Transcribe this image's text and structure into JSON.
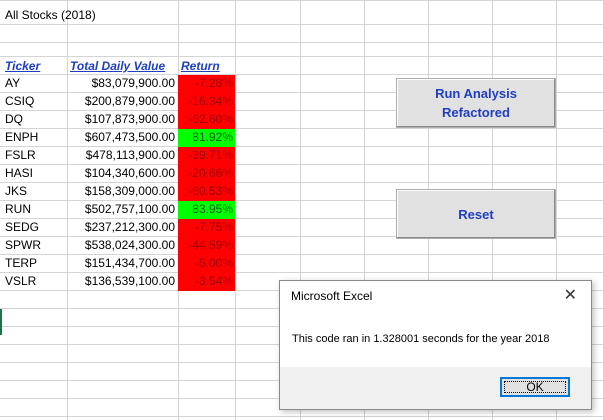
{
  "sheet": {
    "title": "All Stocks (2018)",
    "headers": {
      "ticker": "Ticker",
      "value": "Total Daily Value",
      "ret": "Return"
    },
    "rows": [
      {
        "ticker": "AY",
        "value": "$83,079,900.00",
        "ret": "-7.28%",
        "positive": false
      },
      {
        "ticker": "CSIQ",
        "value": "$200,879,900.00",
        "ret": "-16.34%",
        "positive": false
      },
      {
        "ticker": "DQ",
        "value": "$107,873,900.00",
        "ret": "-62.60%",
        "positive": false
      },
      {
        "ticker": "ENPH",
        "value": "$607,473,500.00",
        "ret": "81.92%",
        "positive": true
      },
      {
        "ticker": "FSLR",
        "value": "$478,113,900.00",
        "ret": "-39.71%",
        "positive": false
      },
      {
        "ticker": "HASI",
        "value": "$104,340,600.00",
        "ret": "-20.66%",
        "positive": false
      },
      {
        "ticker": "JKS",
        "value": "$158,309,000.00",
        "ret": "-60.53%",
        "positive": false
      },
      {
        "ticker": "RUN",
        "value": "$502,757,100.00",
        "ret": "83.95%",
        "positive": true
      },
      {
        "ticker": "SEDG",
        "value": "$237,212,300.00",
        "ret": "-7.75%",
        "positive": false
      },
      {
        "ticker": "SPWR",
        "value": "$538,024,300.00",
        "ret": "-44.59%",
        "positive": false
      },
      {
        "ticker": "TERP",
        "value": "$151,434,700.00",
        "ret": "-5.00%",
        "positive": false
      },
      {
        "ticker": "VSLR",
        "value": "$136,539,100.00",
        "ret": "-3.54%",
        "positive": false
      }
    ]
  },
  "buttons": {
    "run_analysis": "Run Analysis\nRefactored",
    "reset": "Reset"
  },
  "dialog": {
    "title": "Microsoft Excel",
    "message": "This code ran in 1.328001 seconds for the year 2018",
    "ok": "OK"
  },
  "colors": {
    "negative_fill": "#ff0000",
    "positive_fill": "#00ff00",
    "header_text": "#1f3fbf"
  }
}
